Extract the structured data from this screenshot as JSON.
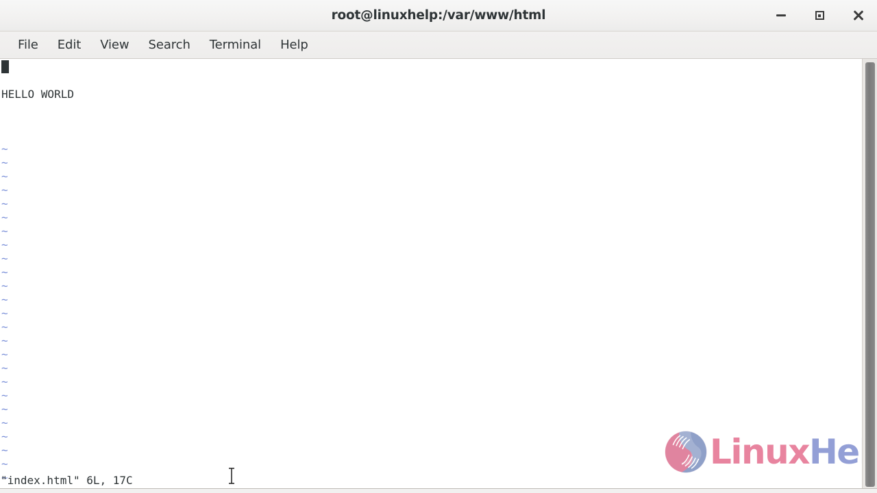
{
  "window": {
    "title": "root@linuxhelp:/var/www/html",
    "controls": {
      "minimize": "minimize",
      "maximize": "maximize",
      "close": "close"
    }
  },
  "menubar": {
    "items": [
      {
        "label": "File"
      },
      {
        "label": "Edit"
      },
      {
        "label": "View"
      },
      {
        "label": "Search"
      },
      {
        "label": "Terminal"
      },
      {
        "label": "Help"
      }
    ]
  },
  "terminal": {
    "editor": "vim",
    "lines": [
      {
        "type": "cursor",
        "text": ""
      },
      {
        "type": "text",
        "text": ""
      },
      {
        "type": "text",
        "text": "HELLO WORLD"
      },
      {
        "type": "text",
        "text": ""
      },
      {
        "type": "text",
        "text": ""
      },
      {
        "type": "text",
        "text": ""
      }
    ],
    "empty_marker": "~",
    "empty_marker_count": 25,
    "statusline": "\"index.html\" 6L, 17C",
    "file_name": "index.html",
    "line_count": "6L",
    "char_count": "17C"
  },
  "scrollbar": {
    "orientation": "vertical",
    "thumb_label": "scroll-thumb"
  },
  "watermark": {
    "brand_first": "Linux",
    "brand_second": "Help",
    "mark_name": "linuxhelp-hands-logo"
  },
  "colors": {
    "titlebar_bg": "#f2f1f0",
    "menubar_bg": "#eeedec",
    "terminal_bg": "#ffffff",
    "terminal_fg": "#2e3436",
    "tilde_blue": "#7a8fd8",
    "scrollbar_thumb": "#7b7b7b",
    "logo_pink": "#e8849f",
    "logo_blue": "#939fd6"
  },
  "mouse": {
    "cursor_type": "text-ibeam"
  }
}
